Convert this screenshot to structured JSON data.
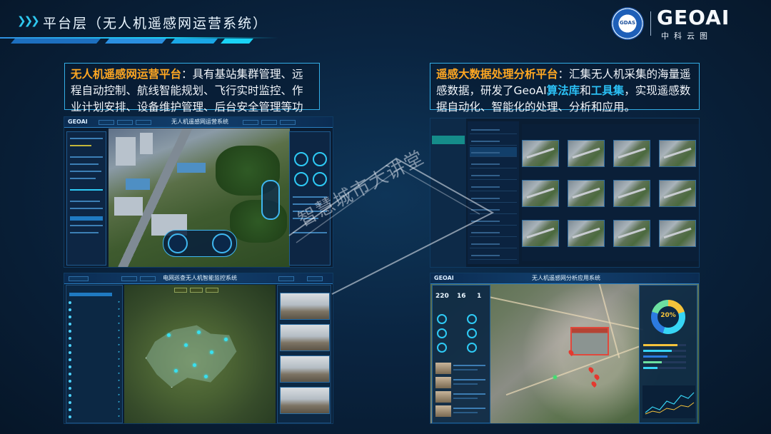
{
  "header": {
    "title": "平台层（无人机遥感网运营系统）",
    "seal_text": "GDAS",
    "brand": "GEOAI",
    "brand_sub": "中科云图"
  },
  "left_desc": {
    "highlight": "无人机遥感网运营平台",
    "text": "：具有基站集群管理、远程自动控制、航线智能规划、飞行实时监控、作业计划安排、设备维护管理、后台安全管理等功能。"
  },
  "right_desc": {
    "highlight": "遥感大数据处理分析平台",
    "text_1": "：汇集无人机采集的海量遥感数据，研发了GeoAI",
    "blue_1": "算法库",
    "text_2": "和",
    "blue_2": "工具集",
    "text_3": "，实现遥感数据自动化、智能化的处理、分析和应用。"
  },
  "screenshots": {
    "top_left": {
      "brand": "GEOAI",
      "title": "无人机遥感网运营系统"
    },
    "bottom_left": {
      "title": "电网巡查无人机智能监控系统"
    },
    "bottom_right": {
      "brand": "GEOAI",
      "title": "无人机遥感网分析应用系统",
      "donut_value": "20%",
      "stat_a": "220",
      "stat_b": "16",
      "stat_c": "1"
    }
  },
  "watermark": "智慧城市大讲堂",
  "colors": {
    "accent": "#2bc0f5",
    "highlight": "#ffa722",
    "border": "#33aee6"
  }
}
